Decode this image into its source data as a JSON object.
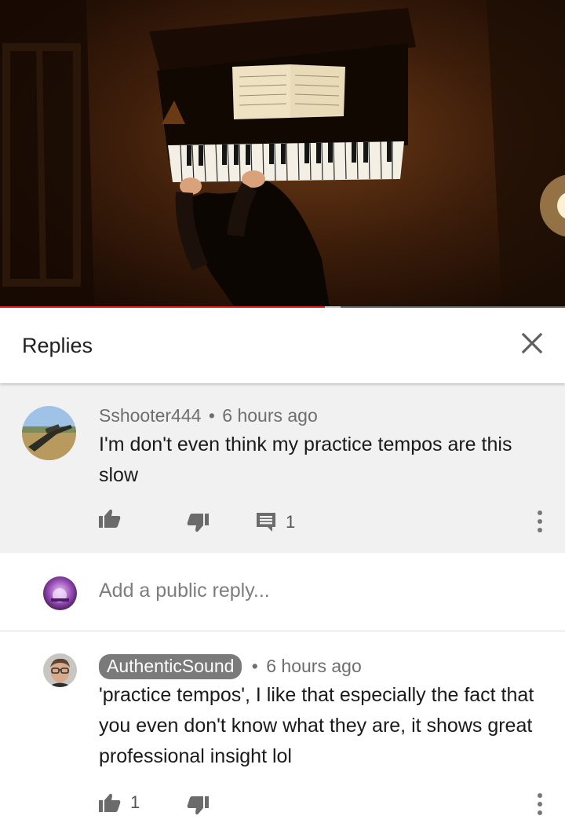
{
  "video": {
    "progress_fraction": 0.575,
    "buffered_fraction": 0.603,
    "progress_color": "#e62117"
  },
  "replies_panel": {
    "title": "Replies",
    "close_icon": "close-icon"
  },
  "parent_comment": {
    "author": "Sshooter444",
    "separator": "•",
    "time": "6 hours ago",
    "text": "I'm don't even think my practice tempos are this slow",
    "like_count": "",
    "reply_count": "1",
    "icons": [
      "thumb-up-icon",
      "thumb-down-icon",
      "reply-icon",
      "more-vert-icon"
    ]
  },
  "add_reply": {
    "placeholder": "Add a public reply..."
  },
  "reply_comment": {
    "author": "AuthenticSound",
    "separator": "•",
    "time": "6 hours ago",
    "text": "'practice tempos', I like that especially the fact that you even don't know what they are, it shows great professional insight lol",
    "like_count": "1",
    "icons": [
      "thumb-up-icon",
      "thumb-down-icon",
      "more-vert-icon"
    ]
  }
}
